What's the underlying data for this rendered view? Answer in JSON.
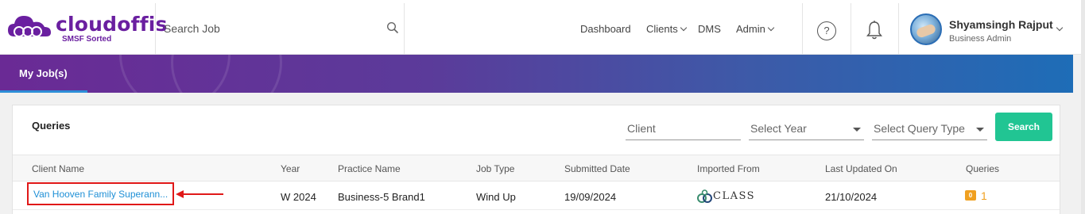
{
  "brand": {
    "name": "cloudoffis",
    "tagline": "SMSF Sorted",
    "color": "#6a1fa0"
  },
  "search": {
    "placeholder": "Search Job",
    "icon": "search-icon"
  },
  "nav": [
    {
      "label": "Dashboard"
    },
    {
      "label": "Clients"
    },
    {
      "label": "DMS"
    },
    {
      "label": "Admin"
    }
  ],
  "header_icons": {
    "help": "?",
    "notifications": "bell-icon"
  },
  "user": {
    "name": "Shyamsingh Rajput",
    "role": "Business Admin"
  },
  "tabs": [
    {
      "label": "My Job(s)",
      "active": true
    }
  ],
  "queries": {
    "title": "Queries",
    "filters": {
      "client_placeholder": "Client",
      "year_placeholder": "Select Year",
      "type_placeholder": "Select Query Type"
    },
    "search_label": "Search",
    "columns": [
      "Client Name",
      "Year",
      "Practice Name",
      "Job Type",
      "Submitted Date",
      "Imported From",
      "Last Updated On",
      "Queries"
    ],
    "rows": [
      {
        "client_name": "Van Hooven Family Superann...",
        "year": "W 2024",
        "practice_name": "Business-5 Brand1",
        "job_type": "Wind Up",
        "submitted_date": "19/09/2024",
        "imported_from": "CLASS",
        "last_updated_on": "21/10/2024",
        "query_badge": "0",
        "query_count": "1"
      }
    ]
  },
  "colors": {
    "accent_green": "#21c593",
    "link_blue": "#1e8fd6",
    "highlight_red": "#e01818",
    "query_orange": "#f0a020"
  }
}
